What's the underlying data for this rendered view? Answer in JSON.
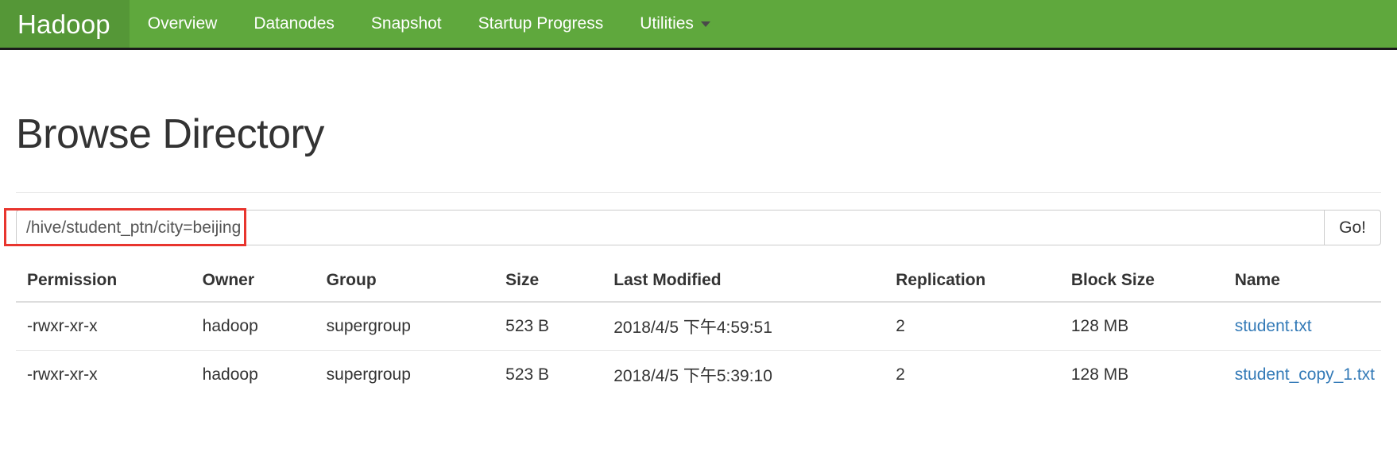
{
  "navbar": {
    "brand": "Hadoop",
    "links": [
      {
        "label": "Overview",
        "has_caret": false
      },
      {
        "label": "Datanodes",
        "has_caret": false
      },
      {
        "label": "Snapshot",
        "has_caret": false
      },
      {
        "label": "Startup Progress",
        "has_caret": false
      },
      {
        "label": "Utilities",
        "has_caret": true
      }
    ],
    "background_color": "#5fa83d",
    "brand_active_color": "#559737"
  },
  "page": {
    "title": "Browse Directory"
  },
  "path_form": {
    "value": "/hive/student_ptn/city=beijing",
    "placeholder": "Enter a path",
    "go_label": "Go!",
    "highlight_color": "#e8352e"
  },
  "table": {
    "headers": [
      "Permission",
      "Owner",
      "Group",
      "Size",
      "Last Modified",
      "Replication",
      "Block Size",
      "Name"
    ],
    "rows": [
      {
        "permission": "-rwxr-xr-x",
        "owner": "hadoop",
        "group": "supergroup",
        "size": "523 B",
        "last_modified": "2018/4/5 下午4:59:51",
        "replication": "2",
        "block_size": "128 MB",
        "name": "student.txt"
      },
      {
        "permission": "-rwxr-xr-x",
        "owner": "hadoop",
        "group": "supergroup",
        "size": "523 B",
        "last_modified": "2018/4/5 下午5:39:10",
        "replication": "2",
        "block_size": "128 MB",
        "name": "student_copy_1.txt"
      }
    ],
    "link_color": "#337ab7"
  }
}
